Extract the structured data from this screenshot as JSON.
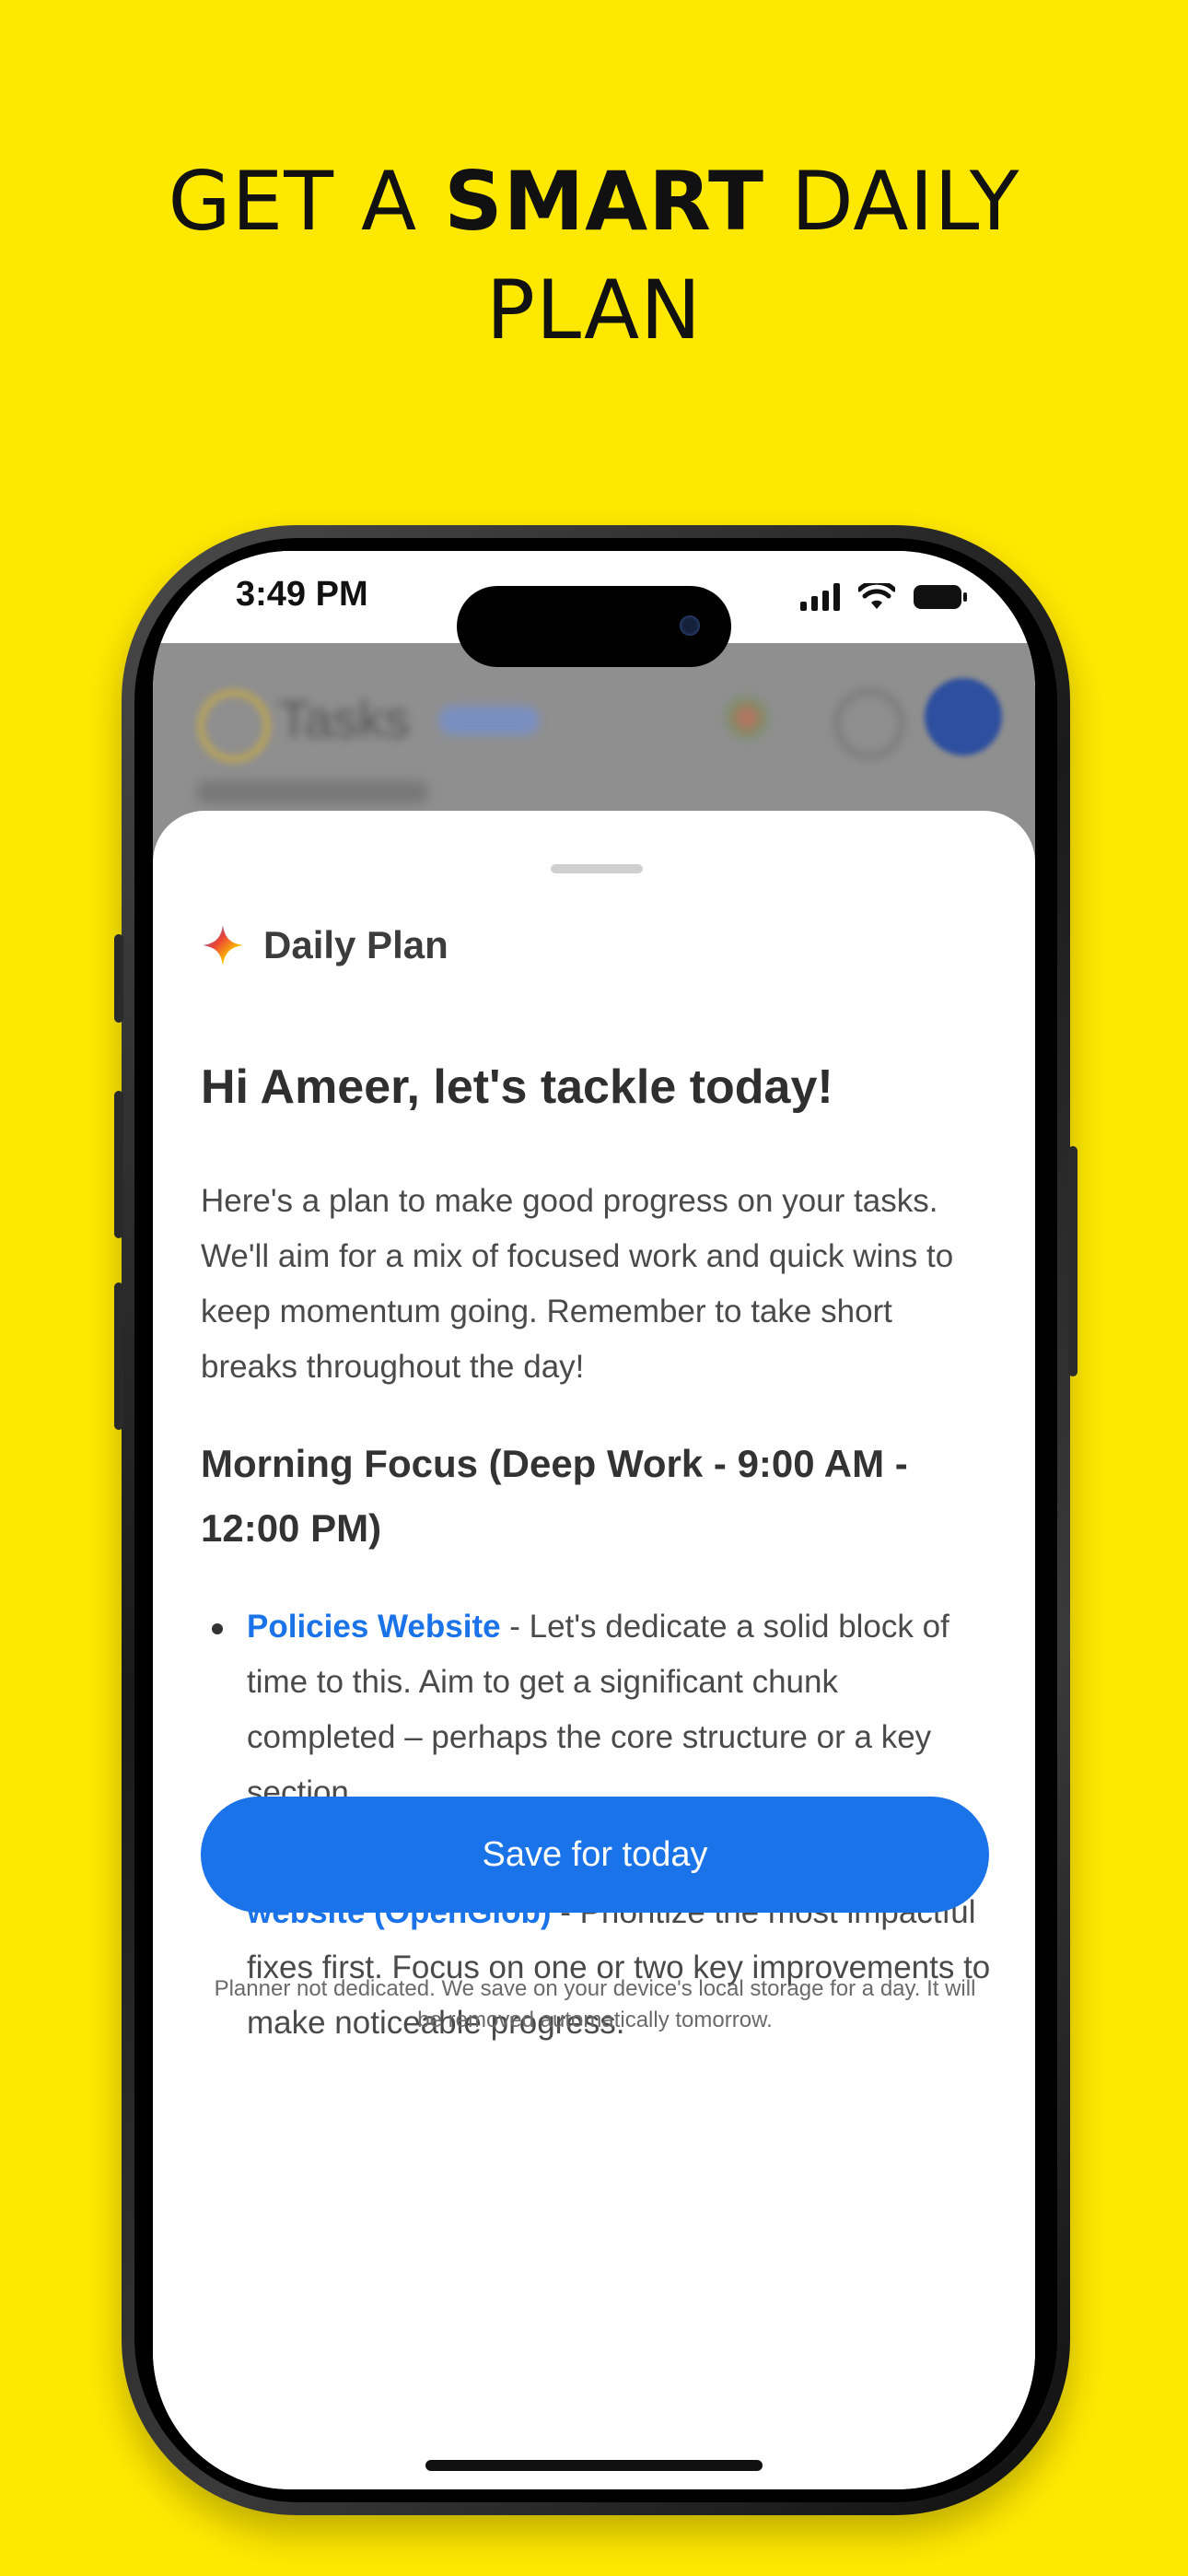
{
  "headline": {
    "line1_pre": "GET A ",
    "line1_bold": "SMART",
    "line1_post": " DAILY",
    "line2": "PLAN"
  },
  "status_bar": {
    "time": "3:49 PM"
  },
  "background_app": {
    "title": "Tasks"
  },
  "sheet": {
    "header_label": "Daily Plan",
    "greeting": "Hi Ameer, let's tackle today!",
    "intro": "Here's a plan to make good progress on your tasks. We'll aim for a mix of focused work and quick wins to keep momentum going. Remember to take short breaks throughout the day!",
    "section_title": "Morning Focus (Deep Work - 9:00 AM - 12:00 PM)",
    "tasks": [
      {
        "name": "Policies Website",
        "description": " - Let's dedicate a solid block of time to this. Aim to get a significant chunk completed – perhaps the core structure or a key section."
      },
      {
        "name": "Improvements and fixes in Account Center website (OpenGlob)",
        "description": " - Prioritize the most impactful fixes first. Focus on one or two key improvements to make noticeable progress."
      }
    ],
    "save_button_label": "Save for today",
    "footer_note": "Planner not dedicated. We save on your device's local storage for a day. It will be removed automatically tomorrow."
  },
  "colors": {
    "background": "#FFE800",
    "accent": "#1a73e8"
  }
}
